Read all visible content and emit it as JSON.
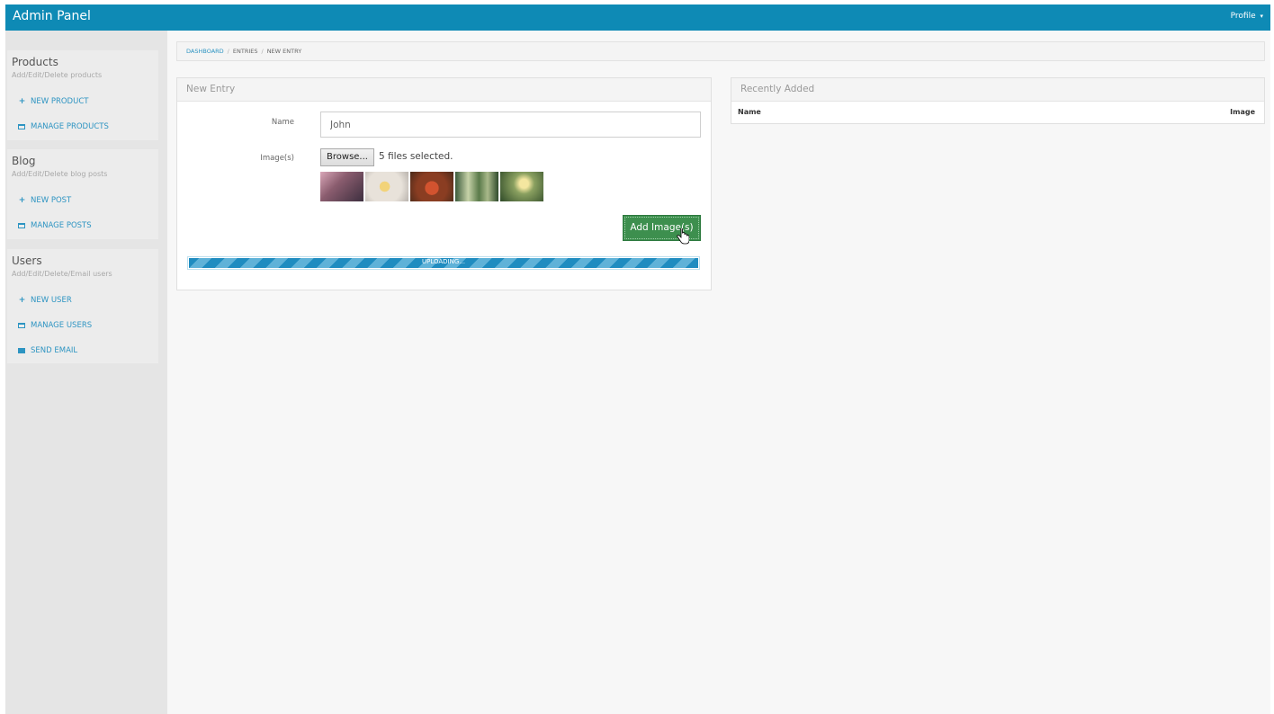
{
  "topbar": {
    "brand": "Admin Panel",
    "profile_label": "Profile",
    "profile_caret": "▾"
  },
  "sidebar": {
    "sections": [
      {
        "title": "Products",
        "subtitle": "Add/Edit/Delete products",
        "items": [
          {
            "icon": "plus-icon",
            "label": "NEW PRODUCT"
          },
          {
            "icon": "table-icon",
            "label": "MANAGE PRODUCTS"
          }
        ]
      },
      {
        "title": "Blog",
        "subtitle": "Add/Edit/Delete blog posts",
        "items": [
          {
            "icon": "plus-icon",
            "label": "NEW POST"
          },
          {
            "icon": "table-icon",
            "label": "MANAGE POSTS"
          }
        ]
      },
      {
        "title": "Users",
        "subtitle": "Add/Edit/Delete/Email users",
        "items": [
          {
            "icon": "plus-icon",
            "label": "NEW USER"
          },
          {
            "icon": "table-icon",
            "label": "MANAGE USERS"
          },
          {
            "icon": "envelope-icon",
            "label": "SEND EMAIL"
          }
        ]
      }
    ]
  },
  "breadcrumb": {
    "items": [
      "DASHBOARD",
      "ENTRIES",
      "NEW ENTRY"
    ],
    "separator": "/"
  },
  "new_entry": {
    "title": "New Entry",
    "name_label": "Name",
    "name_value": "John",
    "images_label": "Image(s)",
    "browse_label": "Browse...",
    "files_selected": "5 files selected.",
    "thumbnail_count": 5,
    "add_button": "Add Image(s)",
    "progress": {
      "label": "UPLOADING...",
      "percent": 100
    }
  },
  "recent": {
    "title": "Recently Added",
    "columns": [
      "Name",
      "Image"
    ]
  },
  "colors": {
    "topbar": "#0e8ab5",
    "link": "#2d94c2",
    "add_button": "#3d8f4e",
    "progress": "#1f8cc0"
  }
}
